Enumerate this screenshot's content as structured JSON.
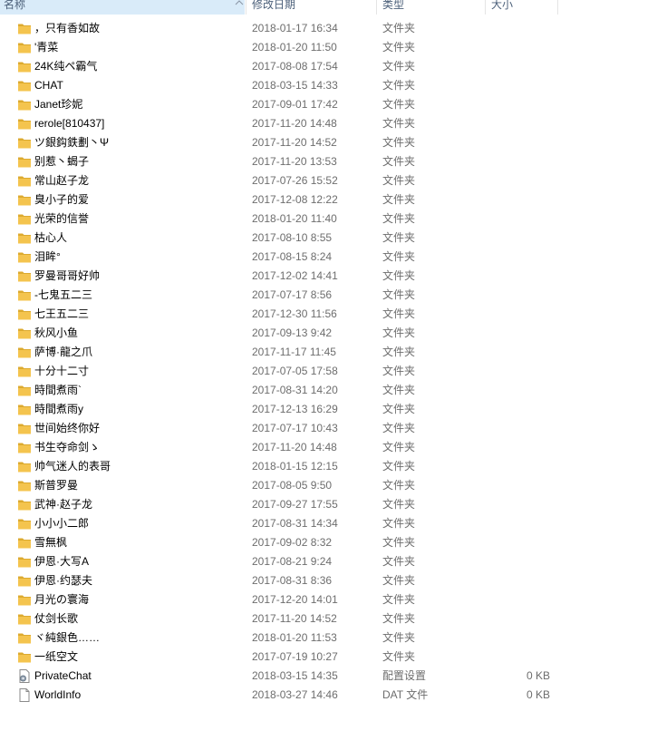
{
  "columns": {
    "name": "名称",
    "date": "修改日期",
    "type": "类型",
    "size": "大小"
  },
  "sort": {
    "column": "name",
    "direction": "ascending"
  },
  "colors": {
    "folder": "#f4c44e",
    "folder_dark": "#dcaa2f",
    "sorted_header": "#d9ebf9",
    "secondary_text": "#6d6d6d"
  },
  "files": [
    {
      "name": "，只有香如故",
      "date": "2018-01-17 16:34",
      "type": "文件夹",
      "size": "",
      "icon": "folder-icon"
    },
    {
      "name": "'青菜",
      "date": "2018-01-20 11:50",
      "type": "文件夹",
      "size": "",
      "icon": "folder-icon"
    },
    {
      "name": "24K纯ペ霸气",
      "date": "2017-08-08 17:54",
      "type": "文件夹",
      "size": "",
      "icon": "folder-icon"
    },
    {
      "name": "CHAT",
      "date": "2018-03-15 14:33",
      "type": "文件夹",
      "size": "",
      "icon": "folder-icon"
    },
    {
      "name": "Janet珍妮",
      "date": "2017-09-01 17:42",
      "type": "文件夹",
      "size": "",
      "icon": "folder-icon"
    },
    {
      "name": "rerole[810437]",
      "date": "2017-11-20 14:48",
      "type": "文件夹",
      "size": "",
      "icon": "folder-icon"
    },
    {
      "name": "ツ銀鈎鉄劃丶Ψ",
      "date": "2017-11-20 14:52",
      "type": "文件夹",
      "size": "",
      "icon": "folder-icon"
    },
    {
      "name": "别惹丶蝎子",
      "date": "2017-11-20 13:53",
      "type": "文件夹",
      "size": "",
      "icon": "folder-icon"
    },
    {
      "name": "常山赵子龙",
      "date": "2017-07-26 15:52",
      "type": "文件夹",
      "size": "",
      "icon": "folder-icon"
    },
    {
      "name": "臭小子的爱",
      "date": "2017-12-08 12:22",
      "type": "文件夹",
      "size": "",
      "icon": "folder-icon"
    },
    {
      "name": "光荣的信誉",
      "date": "2018-01-20 11:40",
      "type": "文件夹",
      "size": "",
      "icon": "folder-icon"
    },
    {
      "name": "枯心人",
      "date": "2017-08-10 8:55",
      "type": "文件夹",
      "size": "",
      "icon": "folder-icon"
    },
    {
      "name": "泪眸°",
      "date": "2017-08-15 8:24",
      "type": "文件夹",
      "size": "",
      "icon": "folder-icon"
    },
    {
      "name": "罗曼哥哥好帅",
      "date": "2017-12-02 14:41",
      "type": "文件夹",
      "size": "",
      "icon": "folder-icon"
    },
    {
      "name": "-七鬼五二三",
      "date": "2017-07-17 8:56",
      "type": "文件夹",
      "size": "",
      "icon": "folder-icon"
    },
    {
      "name": "七王五二三",
      "date": "2017-12-30 11:56",
      "type": "文件夹",
      "size": "",
      "icon": "folder-icon"
    },
    {
      "name": "秋风小鱼",
      "date": "2017-09-13 9:42",
      "type": "文件夹",
      "size": "",
      "icon": "folder-icon"
    },
    {
      "name": "萨博·龍之爪",
      "date": "2017-11-17 11:45",
      "type": "文件夹",
      "size": "",
      "icon": "folder-icon"
    },
    {
      "name": "十分十二寸",
      "date": "2017-07-05 17:58",
      "type": "文件夹",
      "size": "",
      "icon": "folder-icon"
    },
    {
      "name": "時間煮雨`",
      "date": "2017-08-31 14:20",
      "type": "文件夹",
      "size": "",
      "icon": "folder-icon"
    },
    {
      "name": "時間煮雨y",
      "date": "2017-12-13 16:29",
      "type": "文件夹",
      "size": "",
      "icon": "folder-icon"
    },
    {
      "name": "世间始终你好",
      "date": "2017-07-17 10:43",
      "type": "文件夹",
      "size": "",
      "icon": "folder-icon"
    },
    {
      "name": "书生夺命剑ゝ",
      "date": "2017-11-20 14:48",
      "type": "文件夹",
      "size": "",
      "icon": "folder-icon"
    },
    {
      "name": "帅气迷人的表哥",
      "date": "2018-01-15 12:15",
      "type": "文件夹",
      "size": "",
      "icon": "folder-icon"
    },
    {
      "name": "斯普罗曼",
      "date": "2017-08-05 9:50",
      "type": "文件夹",
      "size": "",
      "icon": "folder-icon"
    },
    {
      "name": "武神·赵子龙",
      "date": "2017-09-27 17:55",
      "type": "文件夹",
      "size": "",
      "icon": "folder-icon"
    },
    {
      "name": "小小小二郎",
      "date": "2017-08-31 14:34",
      "type": "文件夹",
      "size": "",
      "icon": "folder-icon"
    },
    {
      "name": "雪無枫",
      "date": "2017-09-02 8:32",
      "type": "文件夹",
      "size": "",
      "icon": "folder-icon"
    },
    {
      "name": "伊恩·大写A",
      "date": "2017-08-21 9:24",
      "type": "文件夹",
      "size": "",
      "icon": "folder-icon"
    },
    {
      "name": "伊恩·约瑟夫",
      "date": "2017-08-31 8:36",
      "type": "文件夹",
      "size": "",
      "icon": "folder-icon"
    },
    {
      "name": "月光の寰海",
      "date": "2017-12-20 14:01",
      "type": "文件夹",
      "size": "",
      "icon": "folder-icon"
    },
    {
      "name": "仗剑长歌",
      "date": "2017-11-20 14:52",
      "type": "文件夹",
      "size": "",
      "icon": "folder-icon"
    },
    {
      "name": "ヾ純銀色……",
      "date": "2018-01-20 11:53",
      "type": "文件夹",
      "size": "",
      "icon": "folder-icon"
    },
    {
      "name": "一纸空文",
      "date": "2017-07-19 10:27",
      "type": "文件夹",
      "size": "",
      "icon": "folder-icon"
    },
    {
      "name": "PrivateChat",
      "date": "2018-03-15 14:35",
      "type": "配置设置",
      "size": "0 KB",
      "icon": "settings-file-icon"
    },
    {
      "name": "WorldInfo",
      "date": "2018-03-27 14:46",
      "type": "DAT 文件",
      "size": "0 KB",
      "icon": "blank-file-icon"
    }
  ]
}
